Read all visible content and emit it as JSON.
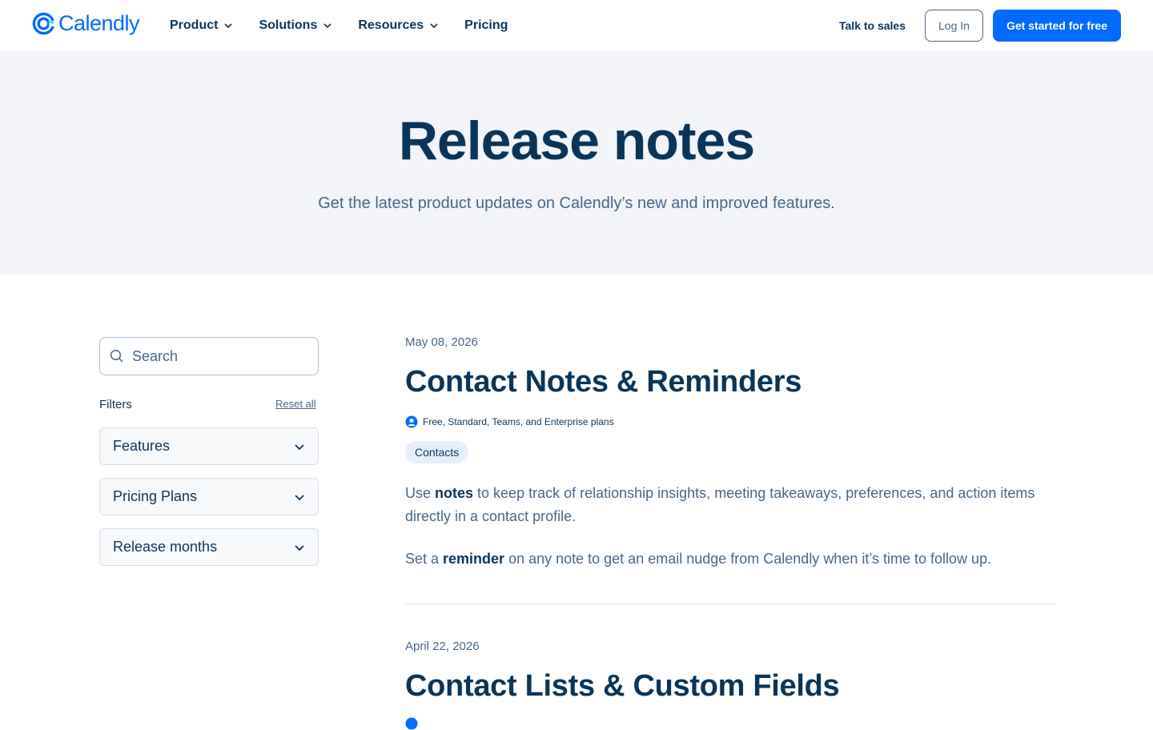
{
  "header": {
    "logo_text": "Calendly",
    "nav": [
      {
        "label": "Product",
        "has_menu": true
      },
      {
        "label": "Solutions",
        "has_menu": true
      },
      {
        "label": "Resources",
        "has_menu": true
      },
      {
        "label": "Pricing",
        "has_menu": false
      }
    ],
    "talk_to_sales": "Talk to sales",
    "login": "Log In",
    "get_started": "Get started for free"
  },
  "hero": {
    "title": "Release notes",
    "subtitle": "Get the latest product updates on Calendly’s new and improved features."
  },
  "sidebar": {
    "search_placeholder": "Search",
    "filters_label": "Filters",
    "reset_label": "Reset all",
    "filters": [
      "Features",
      "Pricing Plans",
      "Release months"
    ]
  },
  "articles": [
    {
      "date": "May 08, 2026",
      "title": "Contact Notes & Reminders",
      "plans": "Free, Standard, Teams, and Enterprise plans",
      "tag": "Contacts",
      "p1_pre": "Use ",
      "p1_bold": "notes",
      "p1_post": " to keep track of relationship insights, meeting takeaways, preferences, and action items directly in a contact profile.",
      "p2_pre": "Set a ",
      "p2_bold": "reminder",
      "p2_post": " on any note to get an email nudge from Calendly when it’s time to follow up."
    },
    {
      "date": "April 22, 2026",
      "title": "Contact Lists & Custom Fields"
    }
  ],
  "colors": {
    "brand": "#006bff",
    "navy": "#0b3558",
    "slate": "#476788",
    "hero_bg": "#f2f4f7"
  }
}
